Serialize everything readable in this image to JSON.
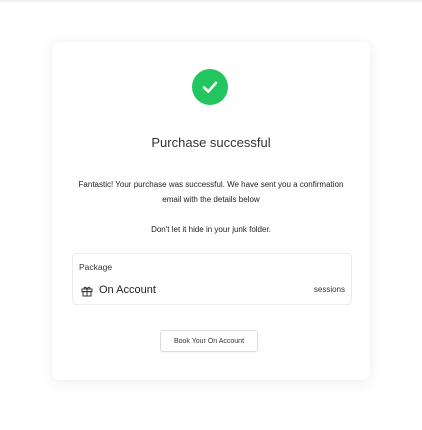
{
  "success": {
    "icon": "check-circle-icon",
    "color": "#22c55e",
    "title": "Purchase successful",
    "message": "Fantastic! Your purchase was successful. We have sent you a confirmation email with the details below",
    "junk_note": "Don't let it hide in your junk folder."
  },
  "package": {
    "label": "Package",
    "icon": "gift-icon",
    "name": "On Account",
    "sessions": "sessions"
  },
  "actions": {
    "book_label": "Book Your On Account"
  }
}
